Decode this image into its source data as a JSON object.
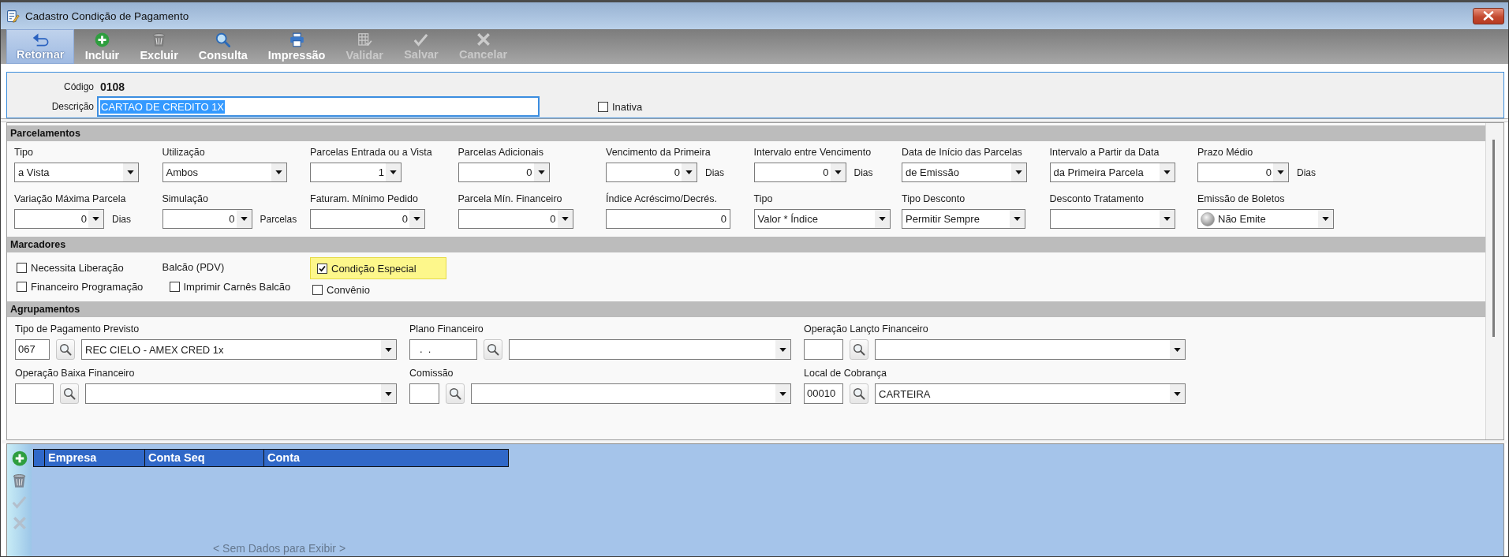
{
  "window": {
    "title": "Cadastro Condição de Pagamento"
  },
  "toolbar": [
    {
      "label": "Retornar",
      "selected": true,
      "disabled": false
    },
    {
      "label": "Incluir",
      "selected": false,
      "disabled": false
    },
    {
      "label": "Excluir",
      "selected": false,
      "disabled": false
    },
    {
      "label": "Consulta",
      "selected": false,
      "disabled": false
    },
    {
      "label": "Impressão",
      "selected": false,
      "disabled": false
    },
    {
      "label": "Validar",
      "selected": false,
      "disabled": true
    },
    {
      "label": "Salvar",
      "selected": false,
      "disabled": true
    },
    {
      "label": "Cancelar",
      "selected": false,
      "disabled": true
    }
  ],
  "header": {
    "code_label": "Código",
    "code": "0108",
    "description_label": "Descrição",
    "description": "CARTAO DE CREDITO 1X",
    "description_selected": true,
    "inactive": {
      "label": "Inativa",
      "checked": false
    }
  },
  "parcelamentos": {
    "title": "Parcelamentos",
    "fields": [
      {
        "label": "Tipo",
        "kind": "select",
        "value": "a Vista"
      },
      {
        "label": "Utilização",
        "kind": "select",
        "value": "Ambos"
      },
      {
        "label": "Parcelas Entrada ou a Vista",
        "kind": "spin",
        "value": "1"
      },
      {
        "label": "Parcelas Adicionais",
        "kind": "spin",
        "value": "0"
      },
      {
        "label": "Vencimento da Primeira",
        "kind": "spin",
        "value": "0",
        "unit": "Dias"
      },
      {
        "label": "Intervalo entre Vencimento",
        "kind": "spin",
        "value": "0",
        "unit": "Dias"
      },
      {
        "label": "Data de Início das Parcelas",
        "kind": "select",
        "value": "de Emissão"
      },
      {
        "label": "Intervalo a Partir da Data",
        "kind": "select",
        "value": "da Primeira Parcela"
      },
      {
        "label": "Prazo Médio",
        "kind": "spin",
        "value": "0",
        "unit": "Dias"
      },
      {
        "label": "Variação Máxima Parcela",
        "kind": "spin",
        "value": "0",
        "unit": "Dias"
      },
      {
        "label": "Simulação",
        "kind": "spin",
        "value": "0",
        "unit": "Parcelas"
      },
      {
        "label": "Faturam. Mínimo Pedido",
        "kind": "spin",
        "value": "0"
      },
      {
        "label": "Parcela Mín. Financeiro",
        "kind": "spin",
        "value": "0"
      },
      {
        "label": "Índice Acréscimo/Decrés.",
        "kind": "input",
        "value": "0"
      },
      {
        "label": "Tipo",
        "kind": "select",
        "value": "Valor * Índice"
      },
      {
        "label": "Tipo Desconto",
        "kind": "select",
        "value": "Permitir Sempre"
      },
      {
        "label": "Desconto Tratamento",
        "kind": "select"
      },
      {
        "label": "Emissão de Boletos",
        "kind": "status_select",
        "value": "Não Emite"
      }
    ]
  },
  "marcadores": {
    "title": "Marcadores",
    "columns": [
      {
        "items": [
          {
            "label": "Necessita Liberação",
            "checked": false,
            "highlighted": false
          },
          {
            "label": "Financeiro Programação",
            "checked": false,
            "highlighted": false
          }
        ]
      },
      {
        "title": "Balcão (PDV)",
        "items": [
          {
            "label": "Imprimir Carnês Balcão",
            "checked": false,
            "highlighted": false
          }
        ]
      },
      {
        "items": [
          {
            "label": "Condição Especial",
            "checked": true,
            "highlighted": true
          },
          {
            "label": "Convênio",
            "checked": false,
            "highlighted": false
          }
        ]
      }
    ]
  },
  "agrupamentos": {
    "title": "Agrupamentos",
    "fields": [
      {
        "label": "Tipo de Pagamento Previsto",
        "code": "067",
        "value": "REC CIELO - AMEX CRED 1x"
      },
      {
        "label": "Plano Financeiro",
        "code": ".  ."
      },
      {
        "label": "Operação Lançto Financeiro"
      },
      {
        "label": "Operação Baixa Financeiro"
      },
      {
        "label": "Comissão"
      },
      {
        "label": "Local de Cobrança",
        "code": "00010",
        "value": "CARTEIRA"
      }
    ]
  },
  "grid": {
    "tools": [
      {
        "disabled": false
      },
      {
        "disabled": false
      },
      {
        "disabled": true
      },
      {
        "disabled": true
      }
    ],
    "columns": [
      "Empresa",
      "Conta Seq",
      "Conta"
    ],
    "empty_text": "< Sem Dados para Exibir >"
  }
}
